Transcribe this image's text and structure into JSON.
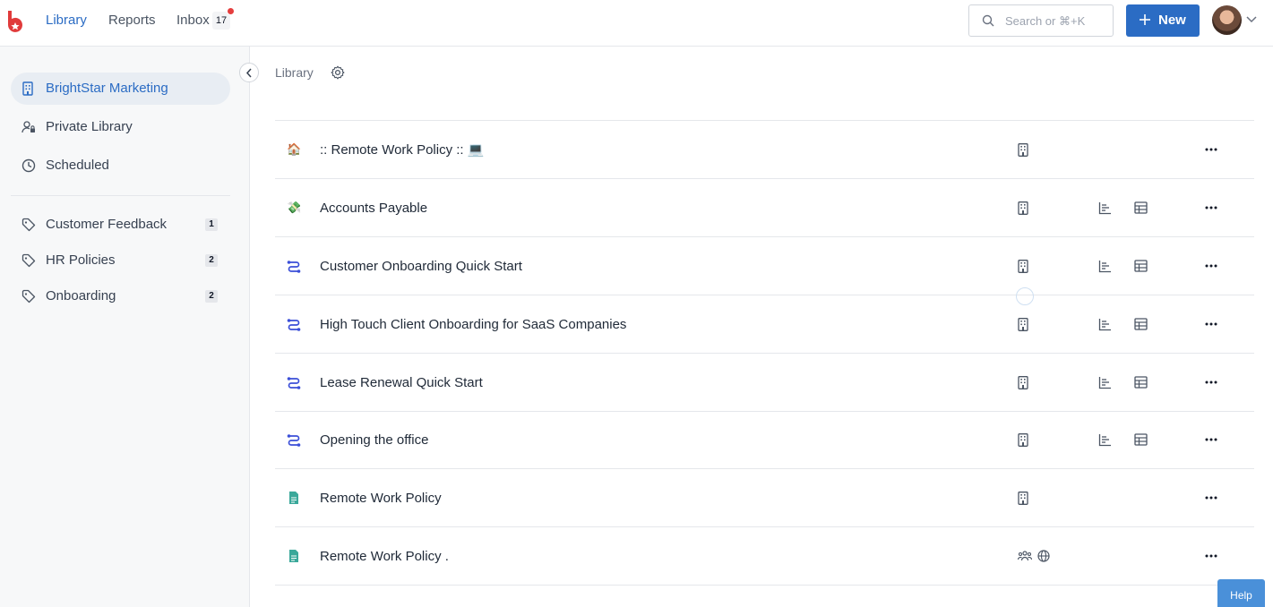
{
  "topbar": {
    "nav": [
      {
        "label": "Library",
        "active": true
      },
      {
        "label": "Reports",
        "active": false
      },
      {
        "label": "Inbox",
        "active": false
      }
    ],
    "inbox_count": "17",
    "search_placeholder": "Search or ⌘+K",
    "new_label": "New",
    "accent_color": "#2b6cc4"
  },
  "sidebar": {
    "items": [
      {
        "label": "BrightStar Marketing",
        "icon": "building-icon"
      },
      {
        "label": "Private Library",
        "icon": "user-lock-icon"
      },
      {
        "label": "Scheduled",
        "icon": "clock-icon"
      }
    ],
    "tags": [
      {
        "label": "Customer Feedback",
        "count": "1"
      },
      {
        "label": "HR Policies",
        "count": "2"
      },
      {
        "label": "Onboarding",
        "count": "2"
      }
    ]
  },
  "main": {
    "breadcrumb": "Library",
    "rows": [
      {
        "title": ":: Remote Work Policy :: 💻",
        "icon": "house-emoji-icon",
        "emoji": "🏠"
      },
      {
        "title": "Accounts Payable",
        "icon": "money-emoji-icon",
        "emoji": "💸"
      },
      {
        "title": "Customer Onboarding Quick Start",
        "icon": "workflow-icon"
      },
      {
        "title": "High Touch Client Onboarding for SaaS Companies",
        "icon": "workflow-icon"
      },
      {
        "title": "Lease Renewal Quick Start",
        "icon": "workflow-icon"
      },
      {
        "title": "Opening the office",
        "icon": "workflow-icon"
      },
      {
        "title": "Remote Work Policy",
        "icon": "document-icon"
      },
      {
        "title": "Remote Work Policy .",
        "icon": "document-icon"
      }
    ]
  },
  "help_label": "Help"
}
